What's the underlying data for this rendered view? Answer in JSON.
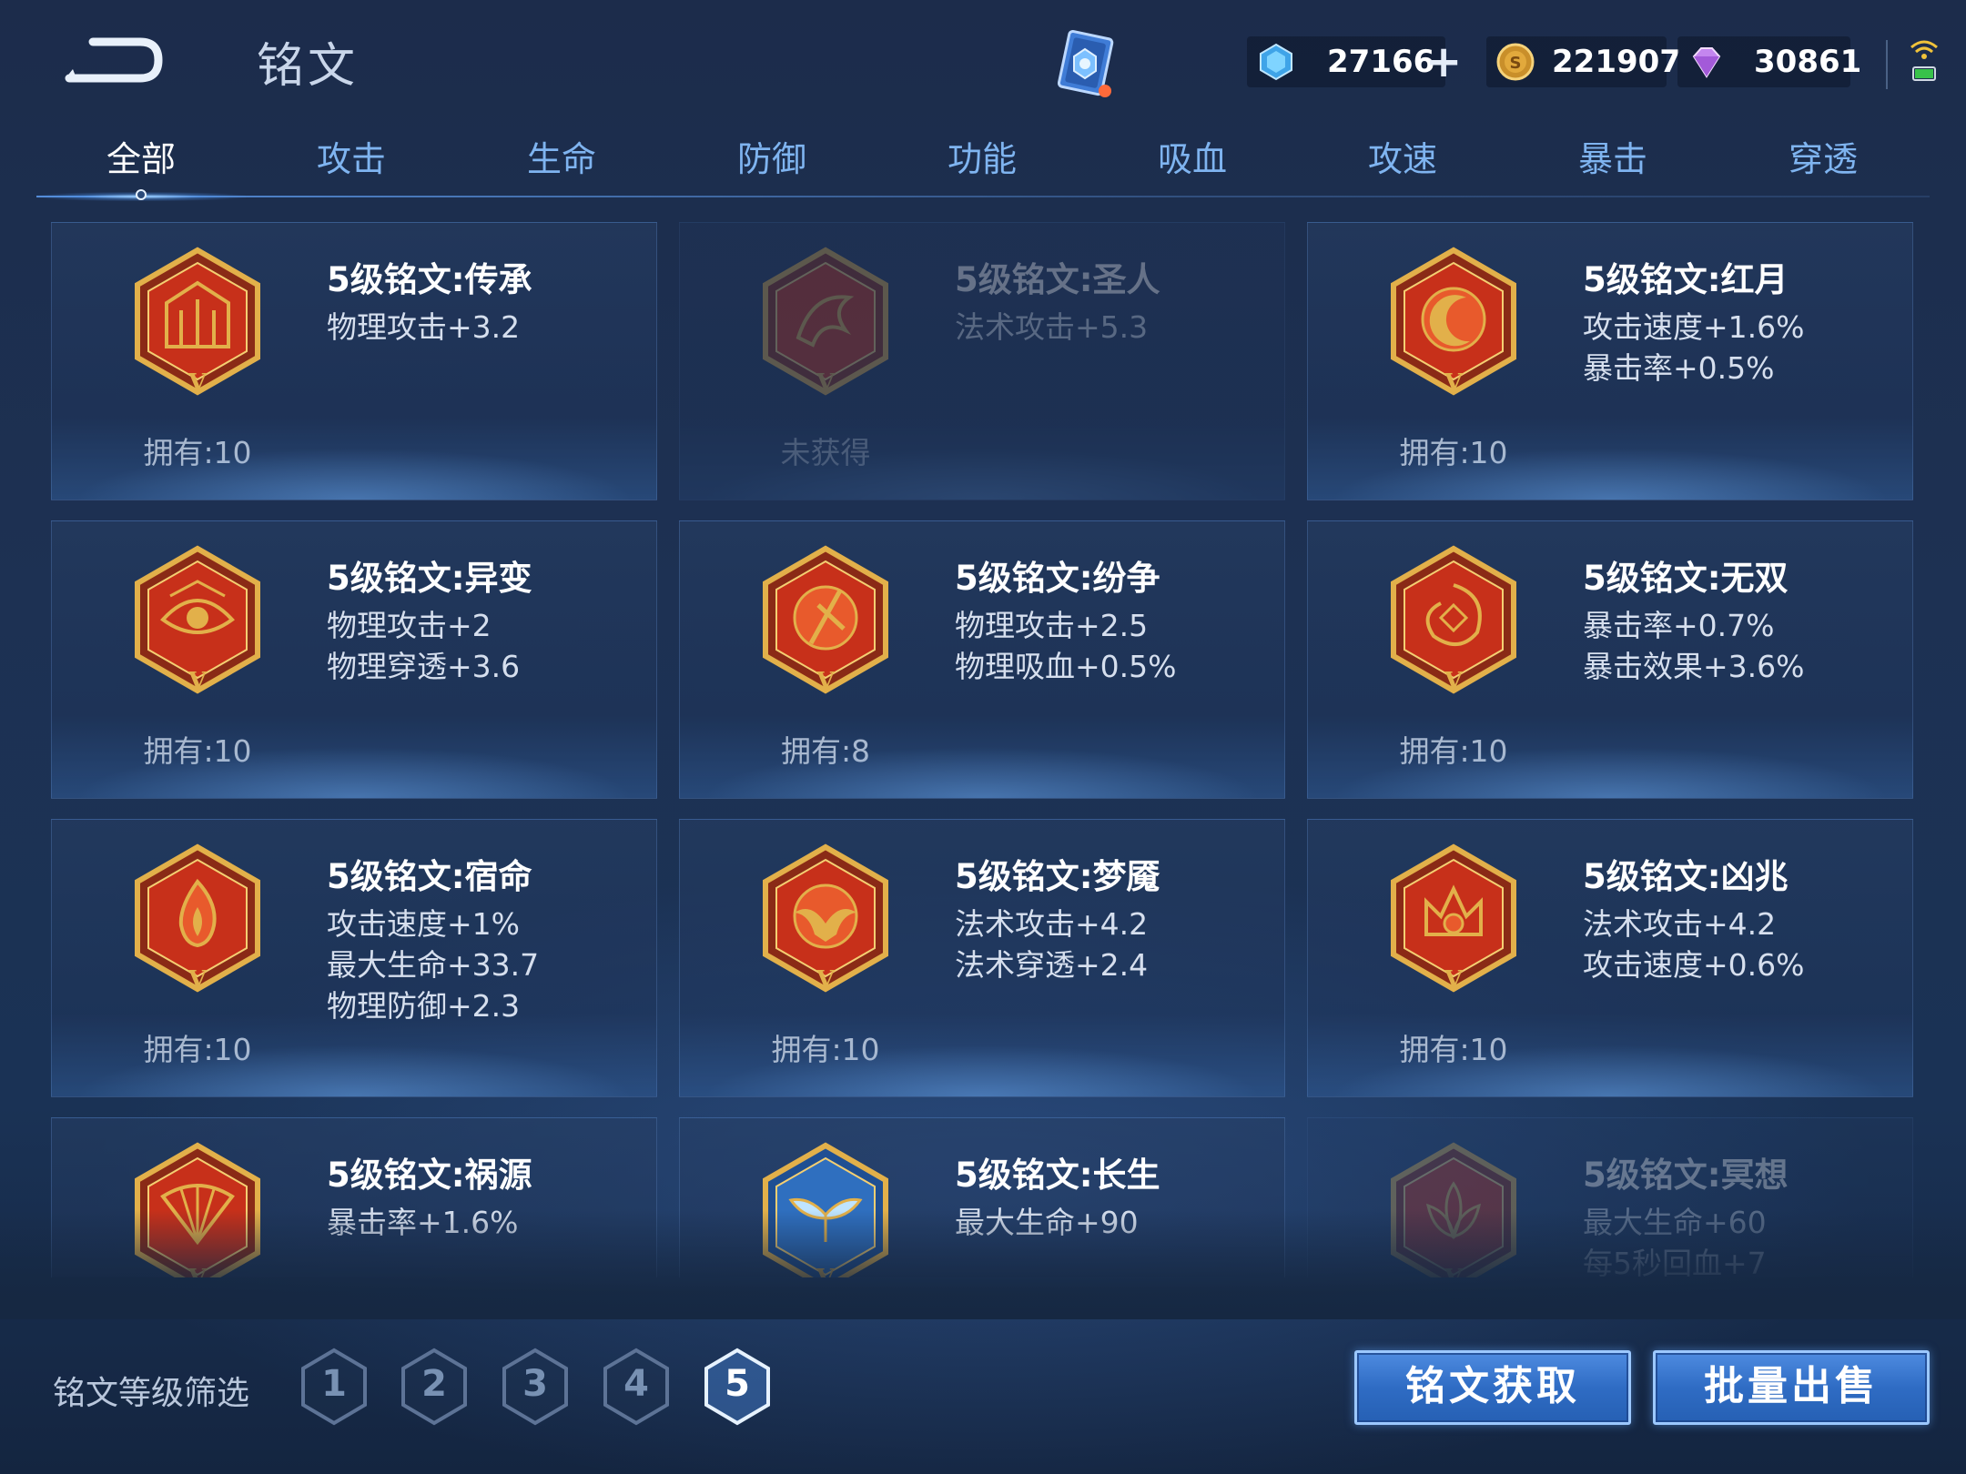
{
  "header": {
    "title": "铭文",
    "crystals": "27166",
    "gold": "221907",
    "gems": "30861"
  },
  "tabs": [
    "全部",
    "攻击",
    "生命",
    "防御",
    "功能",
    "吸血",
    "攻速",
    "暴击",
    "穿透"
  ],
  "active_tab": "全部",
  "cards": [
    {
      "name": "5级铭文:传承",
      "stats": [
        "物理攻击+3.2"
      ],
      "owned": "拥有:10",
      "locked": false,
      "emblem": "sword-gate-emblem"
    },
    {
      "name": "5级铭文:圣人",
      "stats": [
        "法术攻击+5.3"
      ],
      "owned": "未获得",
      "locked": true,
      "emblem": "dragon-emblem"
    },
    {
      "name": "5级铭文:红月",
      "stats": [
        "攻击速度+1.6%",
        "暴击率+0.5%"
      ],
      "owned": "拥有:10",
      "locked": false,
      "emblem": "crescent-moon-emblem"
    },
    {
      "name": "5级铭文:异变",
      "stats": [
        "物理攻击+2",
        "物理穿透+3.6"
      ],
      "owned": "拥有:10",
      "locked": false,
      "emblem": "eye-emblem"
    },
    {
      "name": "5级铭文:纷争",
      "stats": [
        "物理攻击+2.5",
        "物理吸血+0.5%"
      ],
      "owned": "拥有:8",
      "locked": false,
      "emblem": "blade-emblem"
    },
    {
      "name": "5级铭文:无双",
      "stats": [
        "暴击率+0.7%",
        "暴击效果+3.6%"
      ],
      "owned": "拥有:10",
      "locked": false,
      "emblem": "vortex-emblem"
    },
    {
      "name": "5级铭文:宿命",
      "stats": [
        "攻击速度+1%",
        "最大生命+33.7",
        "物理防御+2.3"
      ],
      "owned": "拥有:10",
      "locked": false,
      "emblem": "flame-emblem"
    },
    {
      "name": "5级铭文:梦魇",
      "stats": [
        "法术攻击+4.2",
        "法术穿透+2.4"
      ],
      "owned": "拥有:10",
      "locked": false,
      "emblem": "wings-emblem"
    },
    {
      "name": "5级铭文:凶兆",
      "stats": [
        "法术攻击+4.2",
        "攻击速度+0.6%"
      ],
      "owned": "拥有:10",
      "locked": false,
      "emblem": "crown-emblem"
    },
    {
      "name": "5级铭文:祸源",
      "stats": [
        "暴击率+1.6%"
      ],
      "owned": "",
      "locked": false,
      "emblem": "fan-emblem"
    },
    {
      "name": "5级铭文:长生",
      "stats": [
        "最大生命+90"
      ],
      "owned": "",
      "locked": false,
      "emblem": "whale-tail-emblem"
    },
    {
      "name": "5级铭文:冥想",
      "stats": [
        "最大生命+60",
        "每5秒回血+7"
      ],
      "owned": "",
      "locked": true,
      "emblem": "lotus-emblem"
    }
  ],
  "filter": {
    "label": "铭文等级筛选",
    "levels": [
      "1",
      "2",
      "3",
      "4",
      "5"
    ],
    "active_level": "5"
  },
  "buttons": {
    "acquire": "铭文获取",
    "bulk_sell": "批量出售"
  },
  "colors": {
    "tab_inactive": "#7fb4f0",
    "emblem_red": "#c7301a",
    "emblem_gold": "#e2b04a",
    "emblem_blue": "#3d7fd0",
    "button_blue": "#2f6cc4"
  }
}
